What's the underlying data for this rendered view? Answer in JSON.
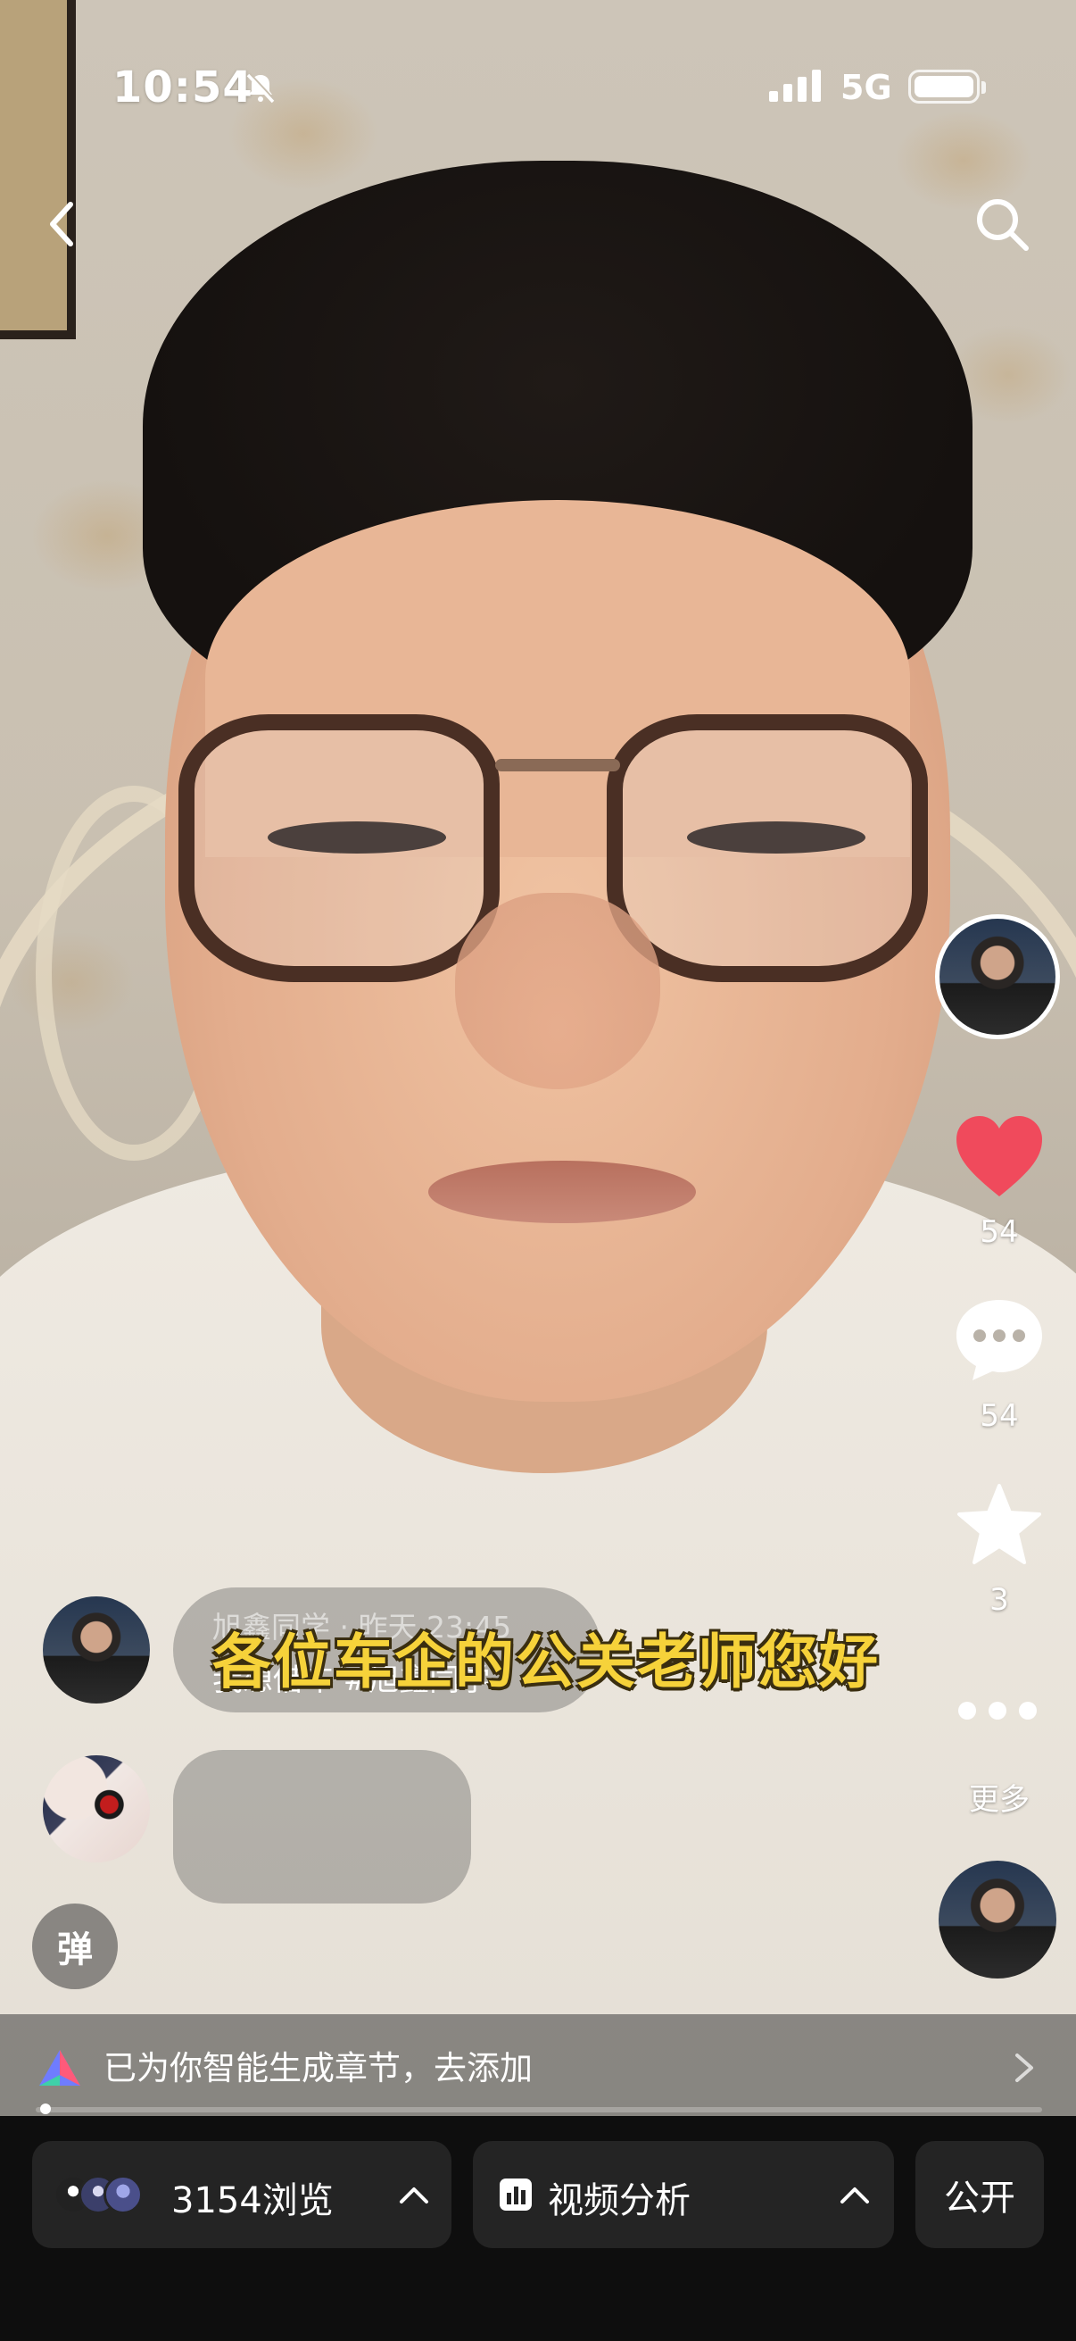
{
  "status_bar": {
    "time": "10:54",
    "network": "5G",
    "icons": [
      "bell-muted-icon",
      "signal-icon",
      "battery-icon"
    ]
  },
  "top_actions": {
    "back_icon": "chevron-left-icon",
    "search_icon": "search-icon"
  },
  "video": {
    "subtitle": "各位车企的公关老师您好"
  },
  "right_rail": {
    "likes": "54",
    "comments": "54",
    "favorites": "3",
    "more_label": "更多",
    "like_color": "#f04a5c"
  },
  "comment_overlay": {
    "author_meta": "旭鑫同学 · 昨天 23:45",
    "text": "我想借车 #旭鑫同学"
  },
  "danmu_label": "弹",
  "chapter_bar": {
    "text": "已为你智能生成章节，去添加"
  },
  "playback": {
    "progress": 0.01
  },
  "bottom_bar": {
    "views_label": "3154浏览",
    "analysis_label": "视频分析",
    "public_label": "公开"
  }
}
